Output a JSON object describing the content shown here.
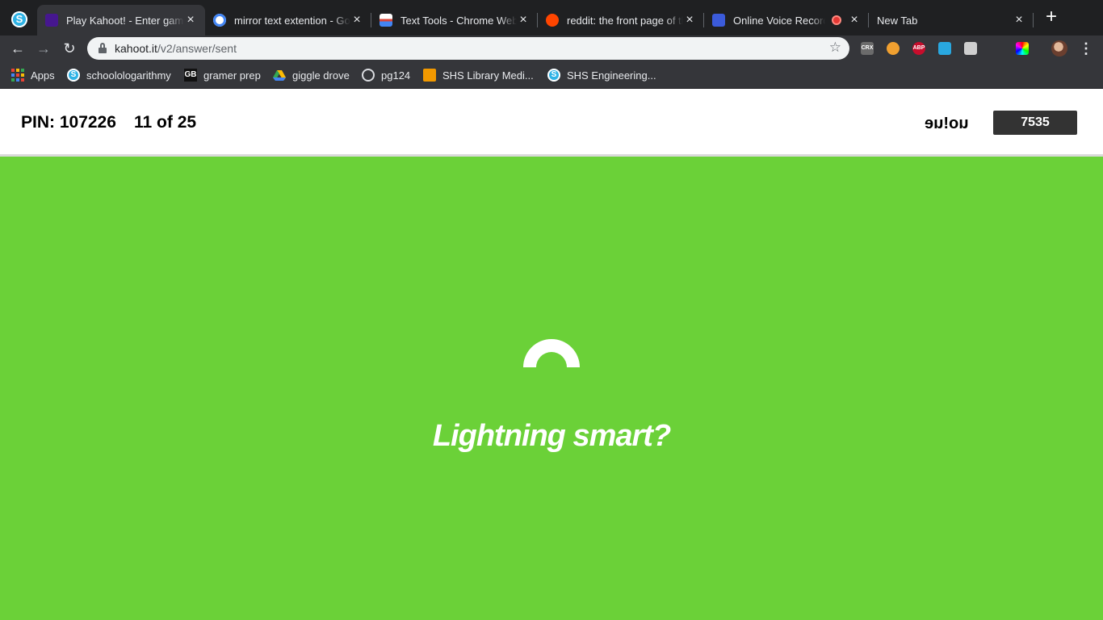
{
  "browser": {
    "tabs": [
      {
        "title": "Play Kahoot! - Enter game PIN here!",
        "active": true,
        "favicon": "kahoot-icon"
      },
      {
        "title": "mirror text extention - Google Search",
        "favicon": "google-icon"
      },
      {
        "title": "Text Tools - Chrome Web Store",
        "favicon": "chrome-web-store-icon"
      },
      {
        "title": "reddit: the front page of the internet",
        "favicon": "reddit-icon"
      },
      {
        "title": "Online Voice Recorder",
        "favicon": "voice-recorder-icon",
        "recording": true
      },
      {
        "title": "New Tab",
        "favicon": ""
      }
    ],
    "new_tab_label": "+",
    "url_host": "kahoot.it",
    "url_path": "/v2/answer/sent",
    "extensions": [
      "CRX",
      "ABP"
    ],
    "bookmarks": [
      {
        "label": "Apps",
        "icon": "apps-grid-icon"
      },
      {
        "label": "schoolologarithmy",
        "icon": "schoology-icon"
      },
      {
        "label": "gramer prep",
        "icon": "gb-icon"
      },
      {
        "label": "giggle drove",
        "icon": "google-drive-icon"
      },
      {
        "label": "pg124",
        "icon": "globe-icon"
      },
      {
        "label": "SHS Library Medi...",
        "icon": "library-icon"
      },
      {
        "label": "SHS Engineering...",
        "icon": "schoology-icon"
      }
    ]
  },
  "game": {
    "pin_label": "PIN: 107226",
    "question_progress": "11 of 25",
    "nickname": "uo!ue",
    "score": "7535",
    "feedback_text": "Lightning smart?",
    "colors": {
      "background": "#6bd138",
      "score_box": "#333333"
    }
  }
}
